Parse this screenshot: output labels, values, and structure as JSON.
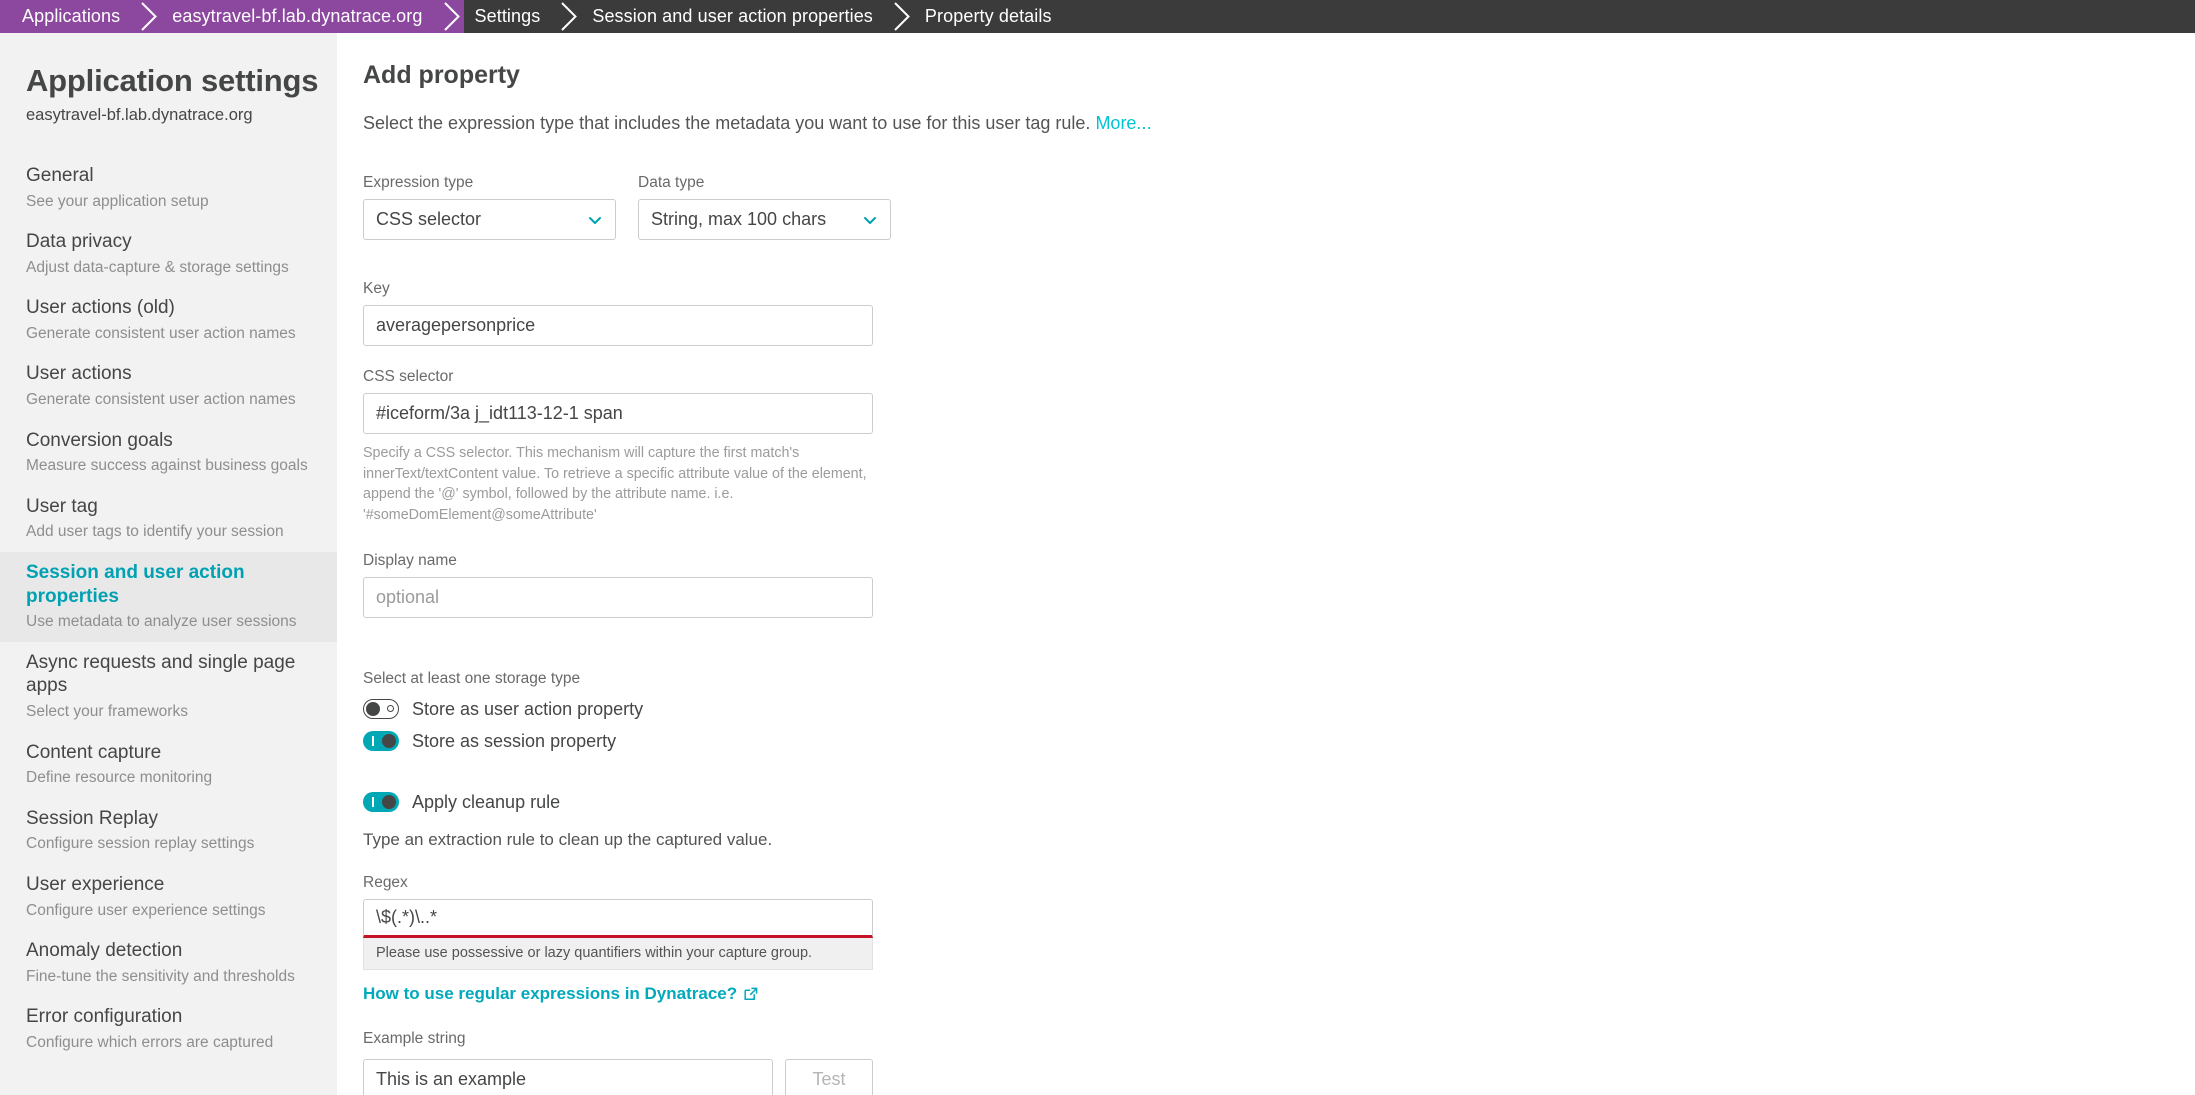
{
  "breadcrumb": {
    "items": [
      {
        "label": "Applications",
        "style": "purple"
      },
      {
        "label": "easytravel-bf.lab.dynatrace.org",
        "style": "purple"
      },
      {
        "label": "Settings",
        "style": "dark"
      },
      {
        "label": "Session and user action properties",
        "style": "dark"
      },
      {
        "label": "Property details",
        "style": "dark"
      }
    ]
  },
  "sidebar": {
    "title": "Application settings",
    "subtitle": "easytravel-bf.lab.dynatrace.org",
    "items": [
      {
        "title": "General",
        "desc": "See your application setup",
        "active": false
      },
      {
        "title": "Data privacy",
        "desc": "Adjust data-capture & storage settings",
        "active": false
      },
      {
        "title": "User actions (old)",
        "desc": "Generate consistent user action names",
        "active": false
      },
      {
        "title": "User actions",
        "desc": "Generate consistent user action names",
        "active": false
      },
      {
        "title": "Conversion goals",
        "desc": "Measure success against business goals",
        "active": false
      },
      {
        "title": "User tag",
        "desc": "Add user tags to identify your session",
        "active": false
      },
      {
        "title": "Session and user action properties",
        "desc": "Use metadata to analyze user sessions",
        "active": true
      },
      {
        "title": "Async requests and single page apps",
        "desc": "Select your frameworks",
        "active": false
      },
      {
        "title": "Content capture",
        "desc": "Define resource monitoring",
        "active": false
      },
      {
        "title": "Session Replay",
        "desc": "Configure session replay settings",
        "active": false
      },
      {
        "title": "User experience",
        "desc": "Configure user experience settings",
        "active": false
      },
      {
        "title": "Anomaly detection",
        "desc": "Fine-tune the sensitivity and thresholds",
        "active": false
      },
      {
        "title": "Error configuration",
        "desc": "Configure which errors are captured",
        "active": false
      }
    ]
  },
  "main": {
    "heading": "Add property",
    "intro_text": "Select the expression type that includes the metadata you want to use for this user tag rule.",
    "intro_link": "More...",
    "expression_type": {
      "label": "Expression type",
      "value": "CSS selector"
    },
    "data_type": {
      "label": "Data type",
      "value": "String, max 100 chars"
    },
    "key": {
      "label": "Key",
      "value": "averagepersonprice"
    },
    "css_selector": {
      "label": "CSS selector",
      "value": "#iceform/3a j_idt113-12-1 span",
      "hint": "Specify a CSS selector. This mechanism will capture the first match's innerText/textContent value. To retrieve a specific attribute value of the element, append the '@' symbol, followed by the attribute name. i.e. '#someDomElement@someAttribute'"
    },
    "display_name": {
      "label": "Display name",
      "placeholder": "optional",
      "value": ""
    },
    "storage": {
      "label": "Select at least one storage type",
      "toggles": [
        {
          "label": "Store as user action property",
          "state": "off"
        },
        {
          "label": "Store as session property",
          "state": "on"
        }
      ]
    },
    "cleanup": {
      "toggle_label": "Apply cleanup rule",
      "toggle_state": "on",
      "description": "Type an extraction rule to clean up the captured value."
    },
    "regex": {
      "label": "Regex",
      "value": "\\$(.*)\\..*",
      "error": "Please use possessive or lazy quantifiers within your capture group.",
      "help_link": "How to use regular expressions in Dynatrace?"
    },
    "example": {
      "label": "Example string",
      "placeholder": "This is an example",
      "test_button": "Test"
    }
  },
  "colors": {
    "breadcrumb_purple": "#8c489f",
    "breadcrumb_dark": "#3b3b3b",
    "accent_teal": "#00a1b2",
    "link_cyan": "#00c3d4",
    "error_red": "#c41425",
    "toggle_on": "#00a8b5"
  }
}
